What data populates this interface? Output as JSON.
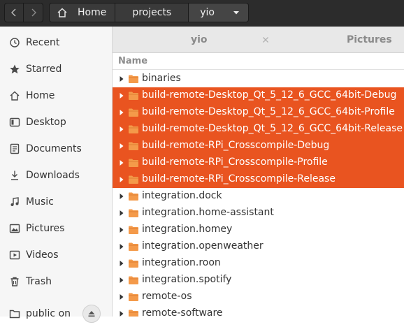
{
  "header": {
    "nav": {
      "back_icon": "chevron-left-icon",
      "forward_icon": "chevron-right-icon"
    },
    "breadcrumbs": [
      {
        "label": "Home",
        "icon": "home-icon"
      },
      {
        "label": "projects"
      },
      {
        "label": "yio",
        "icon": "chevron-down-icon"
      }
    ]
  },
  "sidebar": {
    "items": [
      {
        "label": "Recent",
        "icon": "clock-icon"
      },
      {
        "label": "Starred",
        "icon": "star-icon"
      },
      {
        "label": "Home",
        "icon": "home-icon"
      },
      {
        "label": "Desktop",
        "icon": "desktop-icon"
      },
      {
        "label": "Documents",
        "icon": "document-icon"
      },
      {
        "label": "Downloads",
        "icon": "download-icon"
      },
      {
        "label": "Music",
        "icon": "music-icon"
      },
      {
        "label": "Pictures",
        "icon": "picture-icon"
      },
      {
        "label": "Videos",
        "icon": "video-icon"
      },
      {
        "label": "Trash",
        "icon": "trash-icon"
      },
      {
        "label": "public on",
        "icon": "folder-icon"
      }
    ],
    "eject_icon": "eject-icon"
  },
  "tabs": [
    {
      "label": "yio",
      "close_icon": "close-icon"
    },
    {
      "label": "Pictures"
    }
  ],
  "columns": {
    "name": "Name"
  },
  "files": [
    {
      "name": "binaries",
      "selected": false
    },
    {
      "name": "build-remote-Desktop_Qt_5_12_6_GCC_64bit-Debug",
      "selected": true
    },
    {
      "name": "build-remote-Desktop_Qt_5_12_6_GCC_64bit-Profile",
      "selected": true
    },
    {
      "name": "build-remote-Desktop_Qt_5_12_6_GCC_64bit-Release",
      "selected": true
    },
    {
      "name": "build-remote-RPi_Crosscompile-Debug",
      "selected": true
    },
    {
      "name": "build-remote-RPi_Crosscompile-Profile",
      "selected": true
    },
    {
      "name": "build-remote-RPi_Crosscompile-Release",
      "selected": true
    },
    {
      "name": "integration.dock",
      "selected": false
    },
    {
      "name": "integration.home-assistant",
      "selected": false
    },
    {
      "name": "integration.homey",
      "selected": false
    },
    {
      "name": "integration.openweather",
      "selected": false
    },
    {
      "name": "integration.roon",
      "selected": false
    },
    {
      "name": "integration.spotify",
      "selected": false
    },
    {
      "name": "remote-os",
      "selected": false
    },
    {
      "name": "remote-software",
      "selected": false
    }
  ],
  "colors": {
    "selection": "#e95420",
    "folder": "#f49a4a",
    "header_bg": "#2c2c2c"
  }
}
